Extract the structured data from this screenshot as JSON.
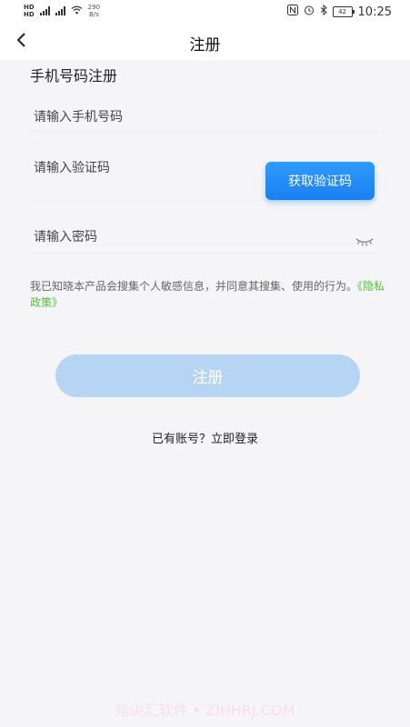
{
  "status_bar": {
    "net_speed_value": "290",
    "net_speed_unit": "B/s",
    "battery": "42",
    "time": "10:25",
    "icons": [
      "nfc-icon",
      "alarm-icon",
      "bluetooth-icon",
      "battery-icon",
      "wifi-icon",
      "signal-icon"
    ]
  },
  "navbar": {
    "back_icon": "back-arrow-icon",
    "title": "注册"
  },
  "form": {
    "section_title": "手机号码注册",
    "phone_placeholder": "请输入手机号码",
    "code_placeholder": "请输入验证码",
    "get_code_label": "获取验证码",
    "password_placeholder": "请输入密码",
    "eye_icon": "eye-closed-icon"
  },
  "agreement": {
    "text": "我已知晓本产品会搜集个人敏感信息，并同意其搜集、使用的行为。",
    "policy_link": "《隐私政策》"
  },
  "register_label": "注册",
  "login_link": "已有账号？立即登录",
  "watermark": "指尖汇软件 • ZIHHRJ.COM",
  "colors": {
    "primary": "#1a7ff0",
    "register_disabled": "#b6d5f5",
    "link_green": "#53c23b",
    "background": "#f5f5f7"
  }
}
